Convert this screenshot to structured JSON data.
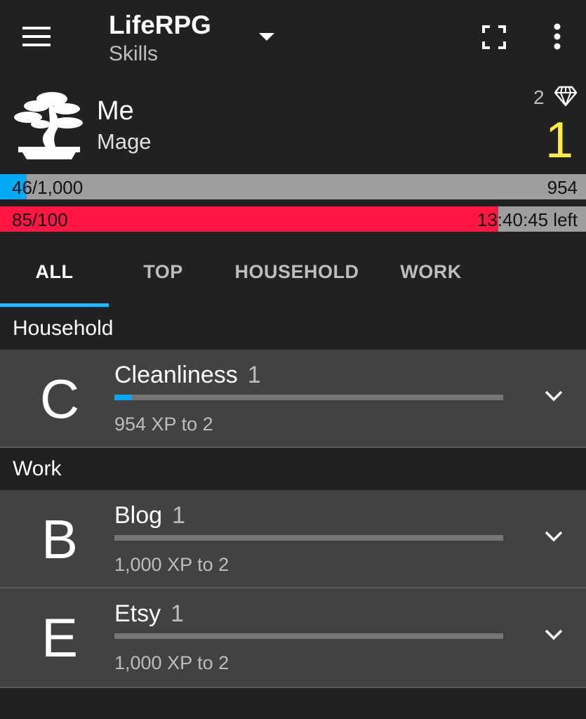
{
  "toolbar": {
    "title": "LifeRPG",
    "subtitle": "Skills"
  },
  "profile": {
    "name": "Me",
    "class": "Mage",
    "gems": "2",
    "level": "1"
  },
  "xp_bar": {
    "left_text": "46/1,000",
    "right_text": "954",
    "progress": 0.046
  },
  "hp_bar": {
    "left_text": "85/100",
    "right_text": "13:40:45 left",
    "progress": 0.85
  },
  "tabs": [
    {
      "label": "ALL",
      "active": true
    },
    {
      "label": "TOP",
      "active": false
    },
    {
      "label": "HOUSEHOLD",
      "active": false
    },
    {
      "label": "WORK",
      "active": false
    }
  ],
  "sections": [
    {
      "title": "Household",
      "skills": [
        {
          "letter": "C",
          "name": "Cleanliness",
          "level": "1",
          "xp_text": "954 XP to 2",
          "progress": 0.046
        }
      ]
    },
    {
      "title": "Work",
      "skills": [
        {
          "letter": "B",
          "name": "Blog",
          "level": "1",
          "xp_text": "1,000 XP to 2",
          "progress": 0
        },
        {
          "letter": "E",
          "name": "Etsy",
          "level": "1",
          "xp_text": "1,000 XP to 2",
          "progress": 0
        }
      ]
    }
  ],
  "colors": {
    "background": "#212121",
    "row_background": "#424242",
    "xp_fill": "#03a9f4",
    "hp_fill": "#ff1744",
    "bar_track": "#9e9e9e",
    "level": "#ffeb3b",
    "tab_indicator": "#29b6f6"
  },
  "icons": {
    "menu": "hamburger-menu-icon",
    "dropdown": "arrow-drop-down-icon",
    "fullscreen": "fullscreen-icon",
    "overflow": "more-vert-icon",
    "gem": "diamond-icon",
    "avatar": "bonsai-tree-icon",
    "expand": "chevron-down-icon"
  }
}
